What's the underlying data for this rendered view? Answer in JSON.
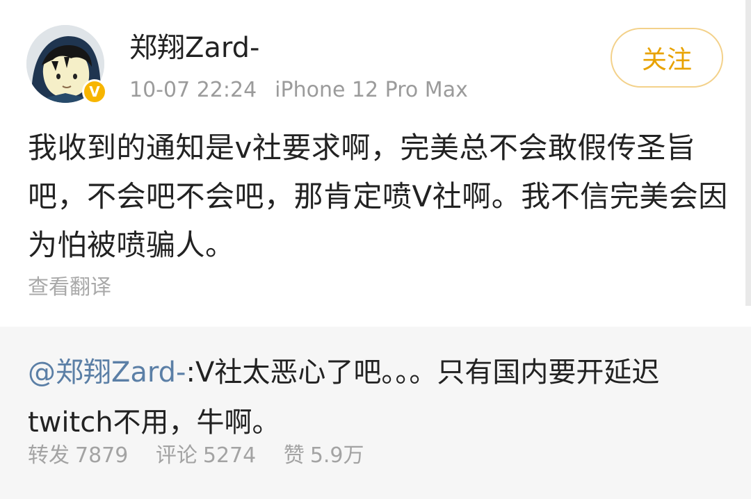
{
  "post": {
    "username": "郑翔Zard-",
    "date": "10-07 22:24",
    "device": "iPhone 12 Pro Max",
    "follow_label": "关注",
    "text": "我收到的通知是v社要求啊，完美总不会敢假传圣旨吧，不会吧不会吧，那肯定喷V社啊。我不信完美会因为怕被喷骗人。",
    "translate_label": "查看翻译",
    "verified_badge": "V"
  },
  "repost": {
    "mention": "@郑翔Zard-",
    "text": ":V社太恶心了吧。。。只有国内要开延迟twitch不用，牛啊。",
    "stats": {
      "repost_label": "转发",
      "repost_count": "7879",
      "comment_label": "评论",
      "comment_count": "5274",
      "like_label": "赞",
      "like_count": "5.9万"
    }
  },
  "icons": {
    "avatar": "cartoon-avatar-icon",
    "verified": "verified-badge-icon"
  },
  "colors": {
    "follow_text": "#e8a200",
    "follow_border": "#f3d18a",
    "mention": "#5b7fa6",
    "verified_badge": "#f7b500",
    "repost_background": "#f6f6f6"
  }
}
